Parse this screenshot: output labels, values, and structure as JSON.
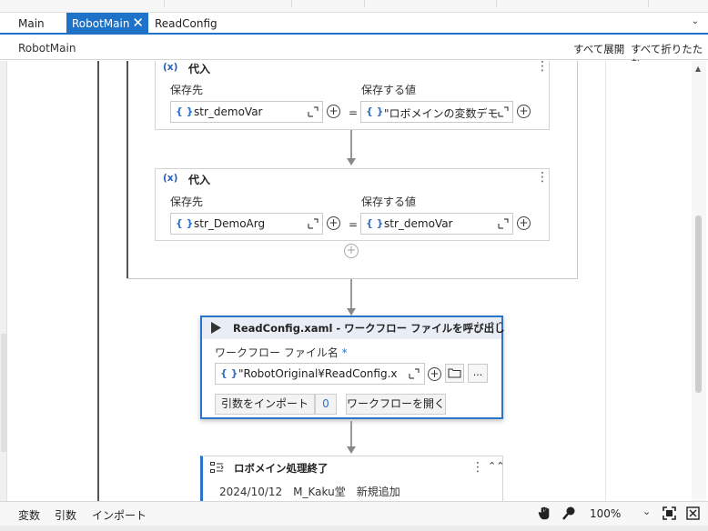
{
  "tabs": [
    {
      "label": "Main",
      "active": false
    },
    {
      "label": "RobotMain",
      "active": true
    },
    {
      "label": "ReadConfig",
      "active": false
    }
  ],
  "header": {
    "title": "RobotMain",
    "expand_all": "すべて展開",
    "collapse_all": "すべて折りたたむ"
  },
  "assign1": {
    "title": "代入",
    "icon_text": "(x)",
    "to_label": "保存先",
    "value_label": "保存する値",
    "to_value": "str_demoVar",
    "value_value": "\"ロボメインの変数デモ\"",
    "equals": "="
  },
  "assign2": {
    "title": "代入",
    "icon_text": "(x)",
    "to_label": "保存先",
    "value_label": "保存する値",
    "to_value": "str_DemoArg",
    "value_value": "str_demoVar",
    "equals": "="
  },
  "invoke": {
    "title": "ReadConfig.xaml - ワークフロー ファイルを呼び出し",
    "file_label": "ワークフロー ファイル名",
    "required_mark": "*",
    "file_value": "\"RobotOriginal¥ReadConfig.xaml\"",
    "browse_label": "...",
    "import_args_label": "引数をインポート",
    "arg_count": "0",
    "open_workflow_label": "ワークフローを開く"
  },
  "comment": {
    "title": "ロボメイン処理終了",
    "text": "2024/10/12　M_Kaku堂　新規追加"
  },
  "footer": {
    "variables": "変数",
    "arguments": "引数",
    "imports": "インポート",
    "zoom": "100%"
  },
  "colors": {
    "accent": "#1e73c8",
    "var_icon": "#2d6fc8"
  }
}
